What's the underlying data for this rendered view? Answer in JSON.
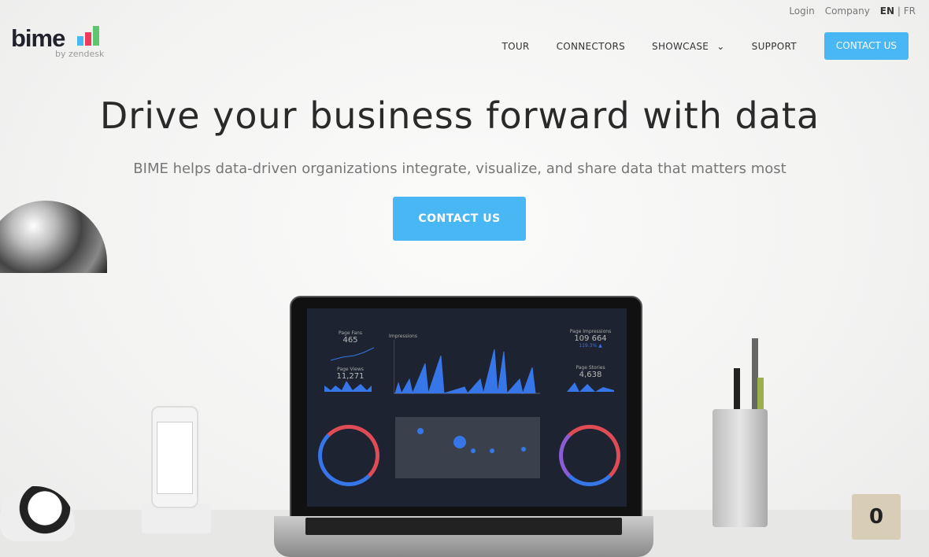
{
  "top_links": {
    "login": "Login",
    "company": "Company",
    "lang_en": "EN",
    "lang_sep": "|",
    "lang_fr": "FR"
  },
  "logo": {
    "word": "bime",
    "by": "by zendesk",
    "bar_colors": [
      "#4ab7f5",
      "#ee3b5b",
      "#5dc66e"
    ]
  },
  "nav": {
    "items": [
      "TOUR",
      "CONNECTORS",
      "SHOWCASE",
      "SUPPORT"
    ],
    "cta": "CONTACT US",
    "showcase_icon": "chevron-down-icon"
  },
  "hero": {
    "title": "Drive your business forward with data",
    "subtitle": "BIME helps data-driven organizations integrate, visualize, and share data that matters most",
    "cta": "CONTACT US",
    "accent": "#4ab7f5"
  },
  "dashboard": {
    "page_fans_label": "Page Fans",
    "page_fans": "465",
    "page_views_label": "Page Views",
    "page_views": "11,271",
    "chart_label": "Impressions",
    "impressions_label": "Page Impressions",
    "impressions": "109 664",
    "impressions_change": "119.3% ▲",
    "stories_label": "Page Stories",
    "stories": "4,638"
  }
}
